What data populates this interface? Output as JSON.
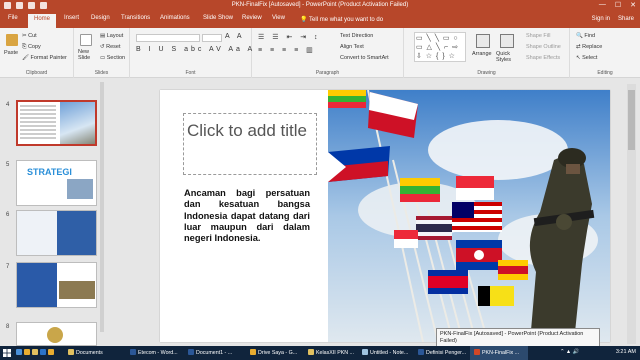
{
  "window": {
    "title": "PKN-FinalFix [Autosaved] - PowerPoint (Product Activation Failed)",
    "controls": [
      "—",
      "☐",
      "✕"
    ]
  },
  "tabs": [
    "File",
    "Home",
    "Insert",
    "Design",
    "Transitions",
    "Animations",
    "Slide Show",
    "Review",
    "View"
  ],
  "active_tab": "Home",
  "tell_me": "Tell me what you want to do",
  "sign_in": "Sign in",
  "share": "Share",
  "ribbon": {
    "clipboard": {
      "paste": "Paste",
      "cut": "Cut",
      "copy": "Copy",
      "format_painter": "Format Painter",
      "label": "Clipboard"
    },
    "slides": {
      "new_slide": "New Slide",
      "layout": "Layout",
      "reset": "Reset",
      "section": "Section",
      "label": "Slides"
    },
    "font": {
      "label": "Font"
    },
    "paragraph": {
      "text_direction": "Text Direction",
      "align_text": "Align Text",
      "convert_smartart": "Convert to SmartArt",
      "label": "Paragraph"
    },
    "drawing": {
      "arrange": "Arrange",
      "quick_styles": "Quick Styles",
      "shape_fill": "Shape Fill",
      "shape_outline": "Shape Outline",
      "shape_effects": "Shape Effects",
      "label": "Drawing"
    },
    "editing": {
      "find": "Find",
      "replace": "Replace",
      "select": "Select",
      "label": "Editing"
    }
  },
  "thumbnails": [
    {
      "num": "4",
      "selected": true
    },
    {
      "num": "5",
      "selected": false,
      "text": "STRATEGI"
    },
    {
      "num": "6",
      "selected": false
    },
    {
      "num": "7",
      "selected": false
    },
    {
      "num": "8",
      "selected": false
    }
  ],
  "slide": {
    "title_placeholder": "Click to add title",
    "body": "Ancaman bagi persatuan dan kesatuan bangsa Indonesia dapat datang dari luar maupun dari dalam negeri Indonesia."
  },
  "tooltip": "PKN-FinalFix [Autosaved] - PowerPoint (Product Activation Failed)",
  "taskbar": {
    "items": [
      "Documents",
      "Etecom - Word...",
      "Document1 - ...",
      "Drive Saya - G...",
      "KelasXII PKN ...",
      "Untitled - Note...",
      "Definisi Penger...",
      "PKN-FinalFix ..."
    ],
    "clock": "3:21 AM"
  }
}
